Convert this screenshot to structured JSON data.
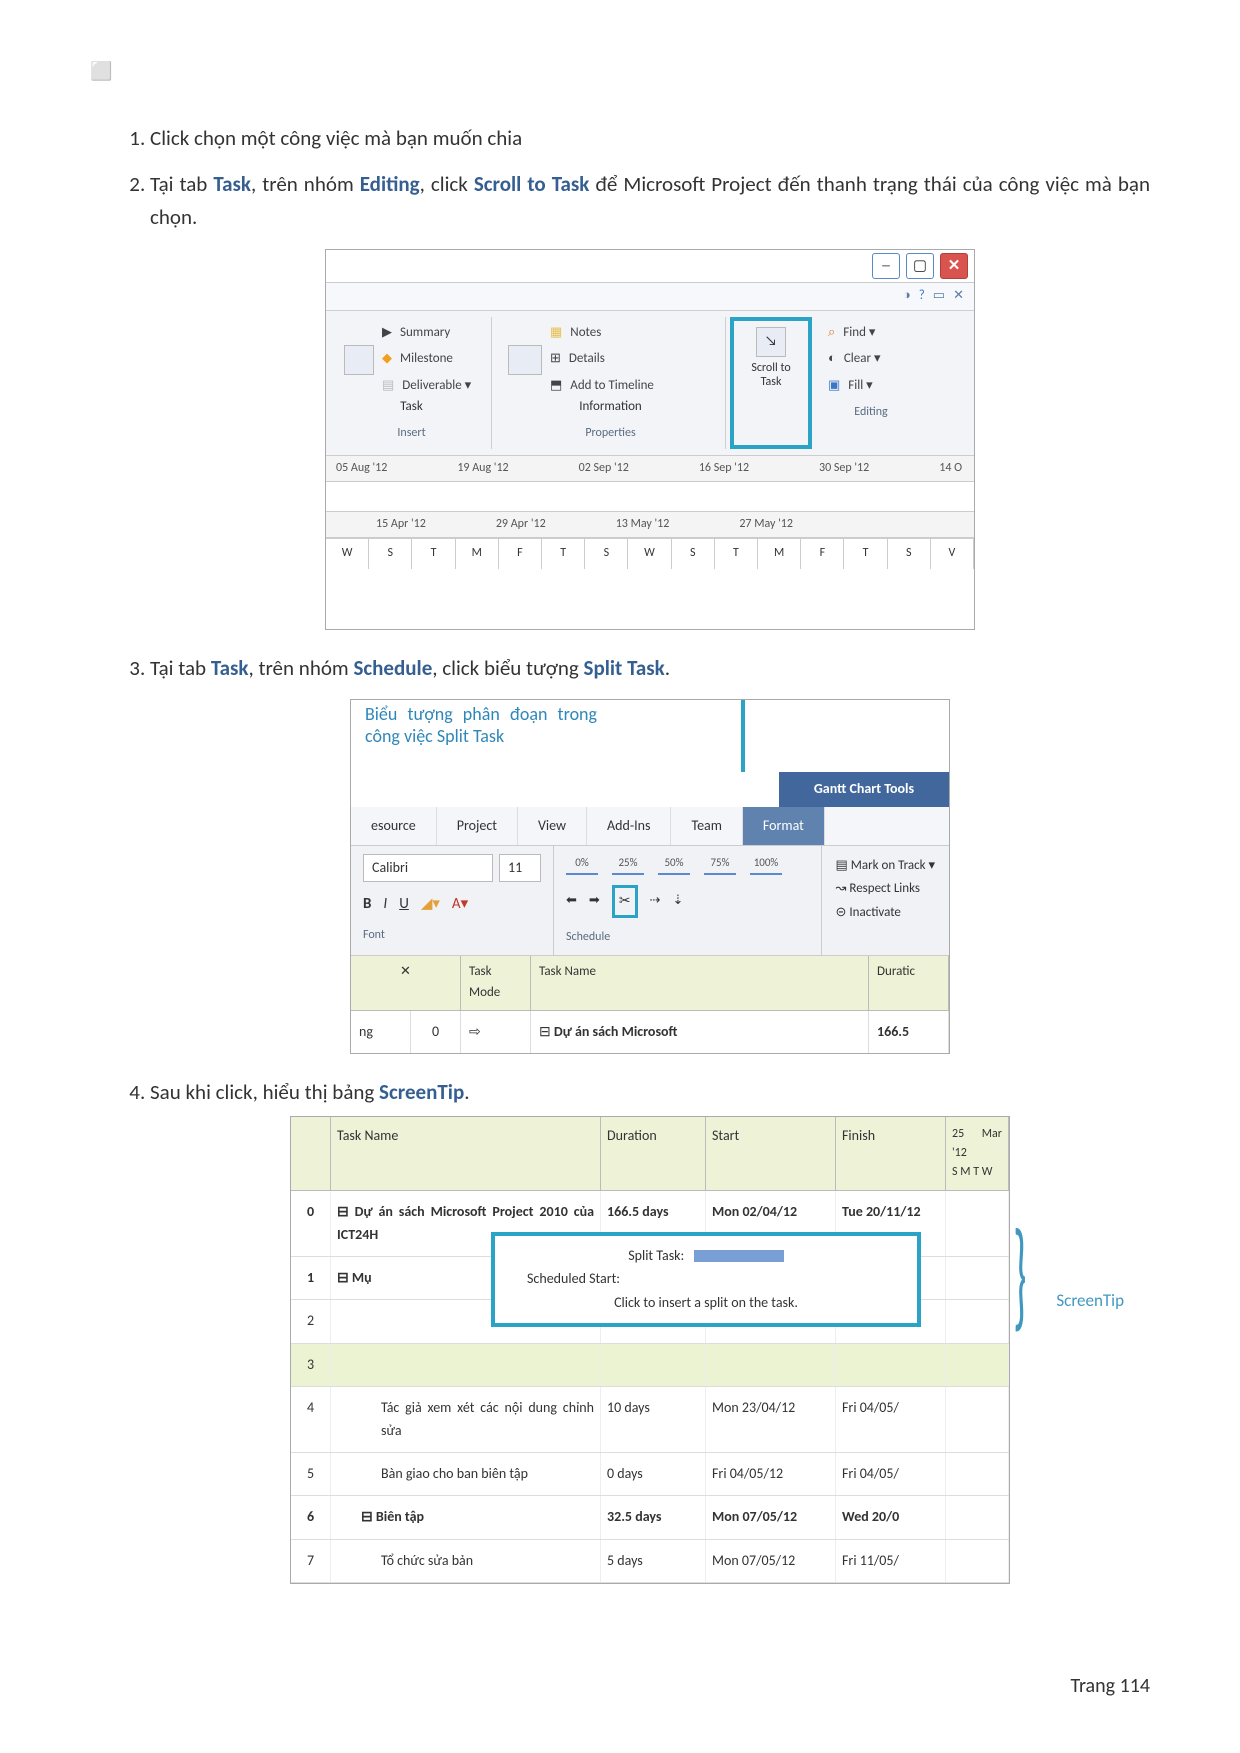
{
  "square": "⬜",
  "steps": {
    "s1": "Click chọn một công việc mà bạn muốn chia",
    "s2a": "Tại tab ",
    "s2b": ", trên nhóm ",
    "s2c": ", click ",
    "s2d": " để Microsoft Project đến thanh trạng thái của công việc mà bạn chọn.",
    "s3a": "Tại tab ",
    "s3c": ", click biểu tượng ",
    "s3end": ".",
    "s4a": "Sau khi click, hiểu thị bảng ",
    "s4end": ".",
    "kw_task": "Task",
    "kw_editing": "Editing",
    "kw_scrolltask": "Scroll to Task",
    "kw_schedule": "Schedule",
    "kw_split": "Split Task",
    "kw_screentip": "ScreenTip"
  },
  "ribbon1": {
    "summary": "Summary",
    "milestone": "Milestone",
    "deliverable": "Deliverable ▾",
    "task": "Task",
    "insert": "Insert",
    "information": "Information",
    "notes": "Notes",
    "details": "Details",
    "addtl": "Add to Timeline",
    "properties": "Properties",
    "scroll": "Scroll to Task",
    "find": "Find ▾",
    "clear": "Clear ▾",
    "fill": "Fill ▾",
    "editing": "Editing",
    "dates1": [
      "05 Aug '12",
      "19 Aug '12",
      "02 Sep '12",
      "16 Sep '12",
      "30 Sep '12",
      "14 O"
    ],
    "dates2": [
      "15 Apr '12",
      "29 Apr '12",
      "13 May '12",
      "27 May '12"
    ],
    "days": [
      "W",
      "S",
      "T",
      "M",
      "F",
      "T",
      "S",
      "W",
      "S",
      "T",
      "M",
      "F",
      "T",
      "S",
      "V"
    ]
  },
  "ribbon2": {
    "caption": "Biểu tượng phân đoạn trong công việc Split Task",
    "ganttTools": "Gantt Chart Tools",
    "tabs": [
      "esource",
      "Project",
      "View",
      "Add-Ins",
      "Team",
      "Format"
    ],
    "fontName": "Calibri",
    "fontSize": "11",
    "fontGroup": "Font",
    "pcts": [
      "0%",
      "25%",
      "50%",
      "75%",
      "100%"
    ],
    "schedule": "Schedule",
    "mark": "Mark on Track ▾",
    "respect": "Respect Links",
    "inactivate": "Inactivate",
    "taskMode": "Task Mode",
    "taskName": "Task Name",
    "duratic": "Duratic",
    "row_ng": "ng",
    "row_zero": "0",
    "row_name": "Dự án sách Microsoft",
    "row_dur": "166.5"
  },
  "table3": {
    "head": {
      "tn": "Task Name",
      "dur": "Duration",
      "start": "Start",
      "finish": "Finish",
      "cal": "25 Mar '12"
    },
    "caldays": "S  M  T  W",
    "rows": [
      {
        "n": "0",
        "name": "Dự án sách Microsoft Project 2010 của ICT24H",
        "dur": "166.5 days",
        "start": "Mon 02/04/12",
        "finish": "Tue 20/11/12",
        "bold": true
      },
      {
        "n": "1",
        "name": "Mụ",
        "bold": true
      },
      {
        "n": "2",
        "name": ""
      },
      {
        "n": "3",
        "name": "",
        "shade": true
      },
      {
        "n": "4",
        "name": "Tác giả xem xét các nội dung chỉnh sửa",
        "dur": "10 days",
        "start": "Mon 23/04/12",
        "finish": "Fri 04/05/"
      },
      {
        "n": "5",
        "name": "Bàn giao cho ban biên tập",
        "dur": "0 days",
        "start": "Fri 04/05/12",
        "finish": "Fri 04/05/"
      },
      {
        "n": "6",
        "name": "Biên tập",
        "dur": "32.5 days",
        "start": "Mon 07/05/12",
        "finish": "Wed 20/0",
        "bold": true
      },
      {
        "n": "7",
        "name": "Tổ chức sửa bản",
        "dur": "5 days",
        "start": "Mon 07/05/12",
        "finish": "Fri 11/05/"
      }
    ]
  },
  "tip": {
    "title": "Split Task:",
    "sched": "Scheduled Start:",
    "hint": "Click to insert a split on the task.",
    "label": "ScreenTip"
  },
  "footer": "Trang 114"
}
